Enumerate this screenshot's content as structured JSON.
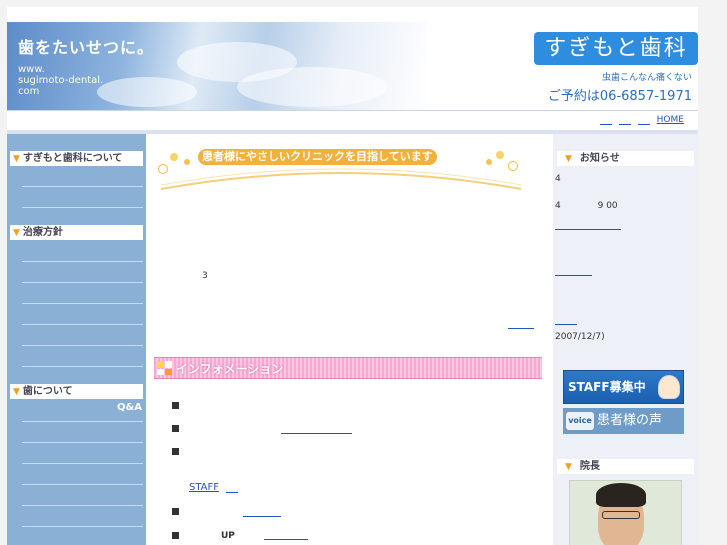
{
  "header": {
    "slogan": "歯をたいせつに。",
    "url_lines": [
      "www.",
      "sugimoto-dental.",
      "com"
    ],
    "clinic_name": "すぎもと歯科",
    "tagline": "虫歯こんなん痛くない",
    "phone": "ご予約は06-6857-1971"
  },
  "topnav": {
    "home": "HOME"
  },
  "left": {
    "sections": [
      {
        "label": "すぎもと歯科について"
      },
      {
        "label": "治療方針"
      },
      {
        "label": "歯について"
      }
    ],
    "qa": "Q&A"
  },
  "main": {
    "hero": "患者様にやさしいクリニックを目指しています",
    "number": "3",
    "info_title": "インフォメーション",
    "staff_link": "STAFF",
    "up_text": "UP"
  },
  "right": {
    "news_title": "お知らせ",
    "news_line1": "4",
    "news_line2_a": "4",
    "news_line2_b": "9 00",
    "news_date": "2007/12/7)",
    "staff_banner": "STAFF募集中",
    "voice_icon": "voice",
    "voice_banner": "患者様の声",
    "director_title": "院長"
  },
  "colors": {
    "sidebar": "#8ab0d6",
    "clinic_badge": "#2f8de0",
    "info_bar": "#f6a8d2",
    "hero_pill": "#f3b13b"
  }
}
